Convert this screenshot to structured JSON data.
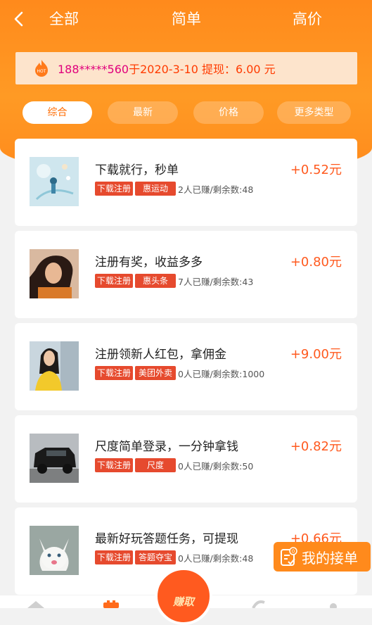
{
  "topbar": {
    "back_icon": "chevron-left-icon",
    "tabs": [
      "全部",
      "简单",
      "高价"
    ]
  },
  "notice": {
    "icon": "hot-flame-icon",
    "hot_label": "HOT",
    "phone": "188*****560",
    "rest": "于2020-3-10 提现：6.00 元"
  },
  "filters": [
    "综合",
    "最新",
    "价格",
    "更多类型"
  ],
  "tasks": [
    {
      "title": "下载就行，秒单",
      "price": "+0.52元",
      "tag1": "下载注册",
      "tag2": "惠运动",
      "stats": "2人已赚/剩余数:48",
      "image": "illustration-thumbnail"
    },
    {
      "title": "注册有奖，收益多多",
      "price": "+0.80元",
      "tag1": "下载注册",
      "tag2": "惠头条",
      "stats": "7人已赚/剩余数:43",
      "image": "woman-portrait-thumbnail"
    },
    {
      "title": "注册领新人红包，拿佣金",
      "price": "+9.00元",
      "tag1": "下载注册",
      "tag2": "美团外卖",
      "stats": "0人已赚/剩余数:1000",
      "image": "woman-yellow-sweater-thumbnail"
    },
    {
      "title": "尺度简单登录，一分钟拿钱",
      "price": "+0.82元",
      "tag1": "下载注册",
      "tag2": "尺度",
      "stats": "0人已赚/剩余数:50",
      "image": "black-suv-thumbnail"
    },
    {
      "title": "最新好玩答题任务，可提现",
      "price": "+0.66元",
      "tag1": "下载注册",
      "tag2": "答题夺宝",
      "stats": "0人已赚/剩余数:48",
      "image": "white-kitten-thumbnail"
    }
  ],
  "float_button": {
    "label": "我的接单",
    "icon": "checklist-icon",
    "badge": "0"
  },
  "center_fab": {
    "label": "赚取"
  },
  "colors": {
    "primary": "#ff8a1c",
    "accent_red": "#e64a2e",
    "price": "#ff5a1f",
    "phone": "#e0007c"
  }
}
